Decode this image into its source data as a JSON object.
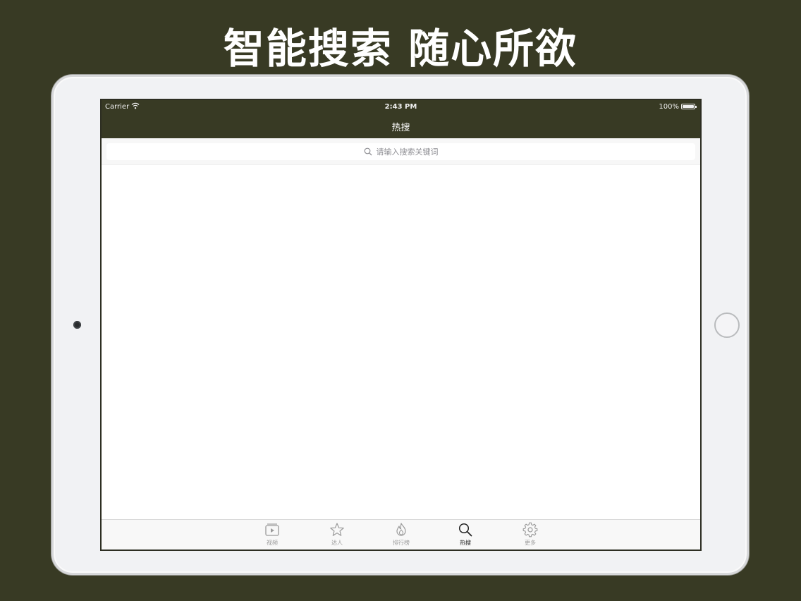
{
  "headline": "智能搜索 随心所欲",
  "status_bar": {
    "carrier": "Carrier",
    "time": "2:43 PM",
    "battery": "100%"
  },
  "nav": {
    "title": "热搜"
  },
  "search": {
    "placeholder": "请输入搜索关键词"
  },
  "tabs": [
    {
      "label": "视频",
      "icon": "video-icon",
      "active": false
    },
    {
      "label": "达人",
      "icon": "star-icon",
      "active": false
    },
    {
      "label": "排行榜",
      "icon": "flame-icon",
      "active": false
    },
    {
      "label": "热搜",
      "icon": "search-icon",
      "active": true
    },
    {
      "label": "更多",
      "icon": "gear-icon",
      "active": false
    }
  ],
  "colors": {
    "background": "#383a24",
    "nav_bar": "#383a24",
    "tab_active": "#222222",
    "tab_inactive": "#9a9a9a"
  }
}
